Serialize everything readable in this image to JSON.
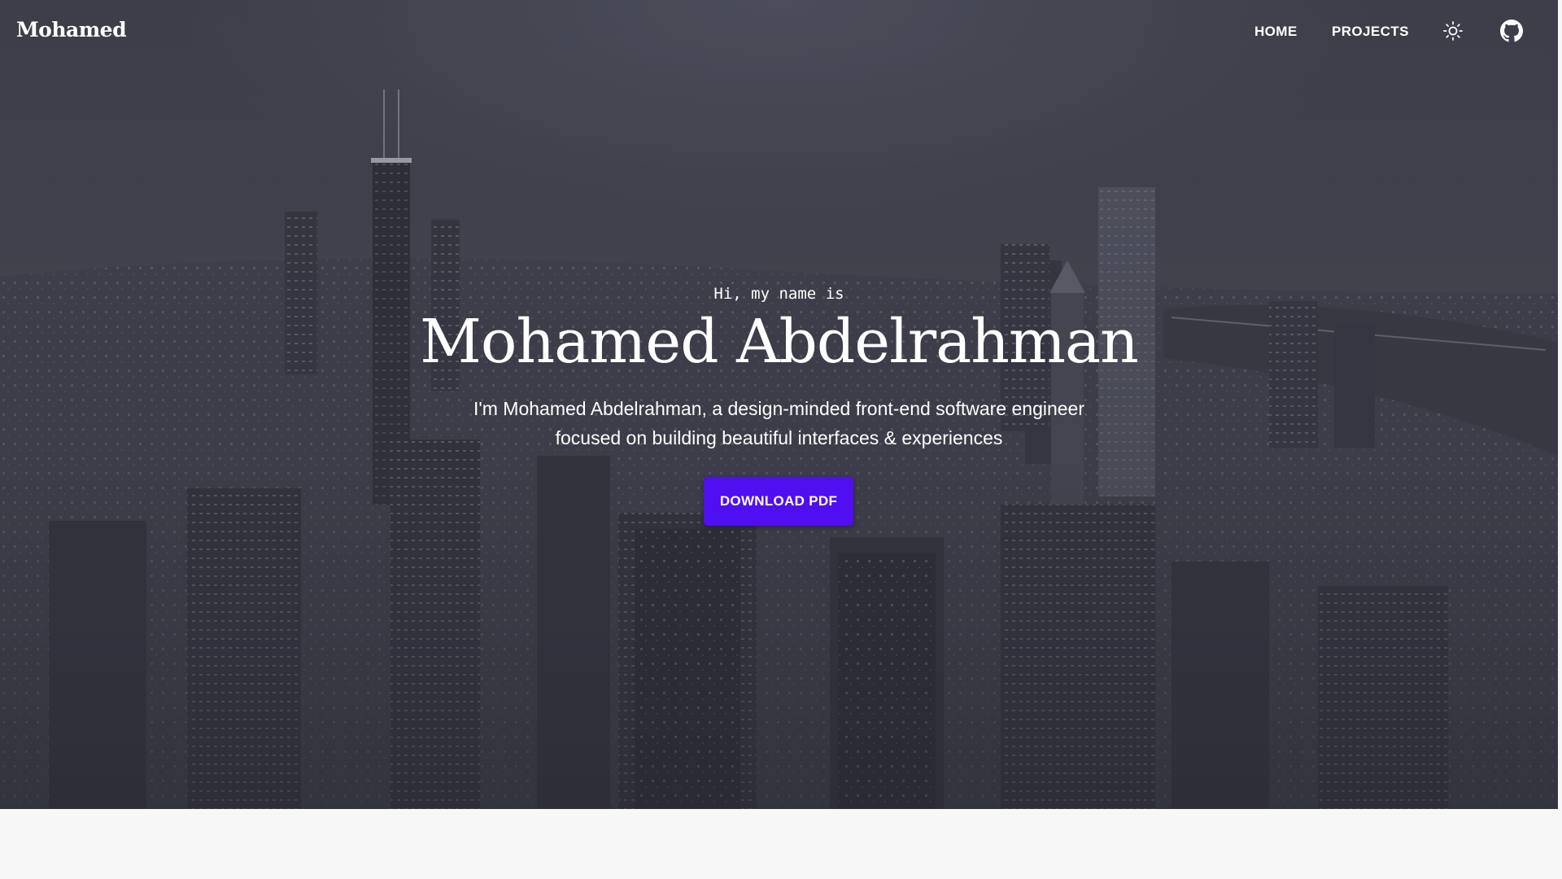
{
  "navbar": {
    "brand": "Mohamed",
    "links": [
      {
        "label": "HOME"
      },
      {
        "label": "PROJECTS"
      }
    ],
    "theme_toggle_icon": "sun-icon",
    "github_icon": "github-icon"
  },
  "hero": {
    "greeting": "Hi, my name is",
    "name": "Mohamed Abdelrahman",
    "tagline_line1": "I'm Mohamed Abdelrahman, a design-minded front-end software engineer",
    "tagline_line2": "focused on building beautiful interfaces & experiences",
    "download_label": "DOWNLOAD PDF",
    "background": "night-city-skyline-photo"
  },
  "colors": {
    "accent": "#4f0ff0",
    "hero_overlay": "#3e3f49",
    "page_background": "#f7f7f8",
    "text_on_hero": "#ffffff"
  }
}
